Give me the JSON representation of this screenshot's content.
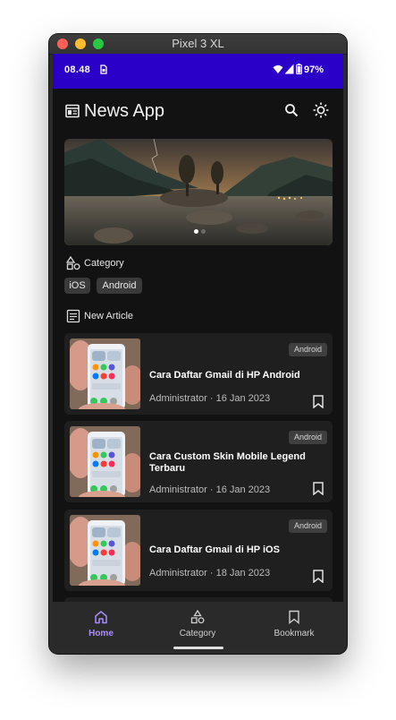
{
  "window": {
    "title": "Pixel 3 XL"
  },
  "status_bar": {
    "time": "08.48",
    "battery": "97%",
    "color": "#2a00c8"
  },
  "app_bar": {
    "title": "News App",
    "icons": [
      "newspaper-icon",
      "search-icon",
      "brightness-icon"
    ]
  },
  "banner": {
    "slides": 2,
    "active_slide": 1
  },
  "category_section": {
    "title": "Category",
    "chips": [
      "iOS",
      "Android"
    ]
  },
  "articles_section": {
    "title": "New Article"
  },
  "articles": [
    {
      "badge": "Android",
      "title": "Cara Daftar Gmail di HP Android",
      "meta": "Administrator · 16 Jan 2023"
    },
    {
      "badge": "Android",
      "title": "Cara Custom Skin Mobile Legend Terbaru",
      "meta": "Administrator · 16 Jan 2023"
    },
    {
      "badge": "Android",
      "title": "Cara Daftar Gmail di HP iOS",
      "meta": "Administrator · 18 Jan 2023"
    }
  ],
  "bottom_nav": {
    "active": "Home",
    "accent": "#a98cff",
    "items": [
      {
        "label": "Home",
        "icon": "home-icon"
      },
      {
        "label": "Category",
        "icon": "category-icon"
      },
      {
        "label": "Bookmark",
        "icon": "bookmark-icon"
      }
    ]
  }
}
